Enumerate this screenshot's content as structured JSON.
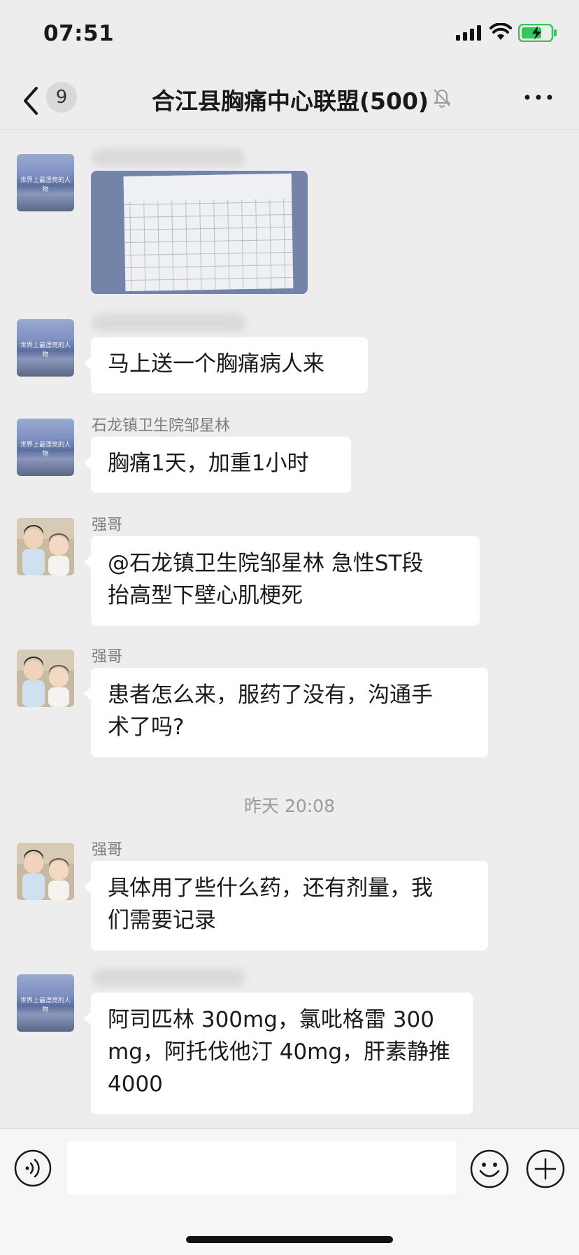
{
  "status_bar": {
    "time": "07:51"
  },
  "nav": {
    "unread_count": "9",
    "title": "合江县胸痛中心联盟(500)"
  },
  "avatar_caption": "世界上最漂亮的人物",
  "messages": [
    {
      "sender": "",
      "type": "image"
    },
    {
      "sender": "",
      "type": "text",
      "text": "马上送一个胸痛病人来"
    },
    {
      "sender": "石龙镇卫生院邹星林",
      "type": "text",
      "text": "胸痛1天，加重1小时"
    },
    {
      "sender": "强哥",
      "type": "text",
      "lines": [
        "@石龙镇卫生院邹星林 急性ST段",
        "抬高型下壁心肌梗死"
      ]
    },
    {
      "sender": "强哥",
      "type": "text",
      "lines": [
        "患者怎么来，服药了没有，沟通手",
        "术了吗?"
      ]
    },
    {
      "type": "timestamp",
      "text": "昨天 20:08"
    },
    {
      "sender": "强哥",
      "type": "text",
      "lines": [
        "具体用了些什么药，还有剂量，我",
        "们需要记录"
      ]
    },
    {
      "sender": "",
      "type": "text",
      "lines": [
        "阿司匹林 300mg，氯吡格雷 300",
        "mg，阿托伐他汀 40mg，肝素静推",
        "4000"
      ]
    }
  ],
  "input": {
    "placeholder": ""
  },
  "icons": {
    "back": "chevron-left-icon",
    "mute": "bell-slash-icon",
    "more": "ellipsis-icon",
    "voice": "voice-icon",
    "emoji": "smiley-icon",
    "plus": "plus-icon"
  },
  "colors": {
    "background": "#ededed",
    "bubble": "#ffffff",
    "battery": "#34c759"
  }
}
